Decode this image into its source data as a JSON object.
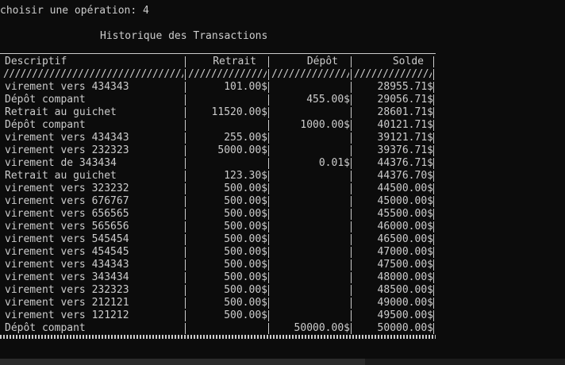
{
  "console": {
    "prompt": "choisir une opération: 4",
    "title": "Historique des Transactions"
  },
  "table": {
    "headers": {
      "description": "Descriptif",
      "retrait": "Retrait",
      "depot": "Dépôt",
      "solde": "Solde"
    },
    "rows": [
      {
        "description": "virement vers 434343",
        "retrait": "101.00$",
        "depot": "",
        "solde": "28955.71$"
      },
      {
        "description": "Dépôt compant",
        "retrait": "",
        "depot": "455.00$",
        "solde": "29056.71$"
      },
      {
        "description": "Retrait au guichet",
        "retrait": "11520.00$",
        "depot": "",
        "solde": "28601.71$"
      },
      {
        "description": "Dépôt compant",
        "retrait": "",
        "depot": "1000.00$",
        "solde": "40121.71$"
      },
      {
        "description": "virement vers 434343",
        "retrait": "255.00$",
        "depot": "",
        "solde": "39121.71$"
      },
      {
        "description": "virement vers 232323",
        "retrait": "5000.00$",
        "depot": "",
        "solde": "39376.71$"
      },
      {
        "description": "virement de 343434",
        "retrait": "",
        "depot": "0.01$",
        "solde": "44376.71$"
      },
      {
        "description": "Retrait au guichet",
        "retrait": "123.30$",
        "depot": "",
        "solde": "44376.70$"
      },
      {
        "description": "virement vers 323232",
        "retrait": "500.00$",
        "depot": "",
        "solde": "44500.00$"
      },
      {
        "description": "virement vers 676767",
        "retrait": "500.00$",
        "depot": "",
        "solde": "45000.00$"
      },
      {
        "description": "virement vers 656565",
        "retrait": "500.00$",
        "depot": "",
        "solde": "45500.00$"
      },
      {
        "description": "virement vers 565656",
        "retrait": "500.00$",
        "depot": "",
        "solde": "46000.00$"
      },
      {
        "description": "virement vers 545454",
        "retrait": "500.00$",
        "depot": "",
        "solde": "46500.00$"
      },
      {
        "description": "virement vers 454545",
        "retrait": "500.00$",
        "depot": "",
        "solde": "47000.00$"
      },
      {
        "description": "virement vers 434343",
        "retrait": "500.00$",
        "depot": "",
        "solde": "47500.00$"
      },
      {
        "description": "virement vers 343434",
        "retrait": "500.00$",
        "depot": "",
        "solde": "48000.00$"
      },
      {
        "description": "virement vers 232323",
        "retrait": "500.00$",
        "depot": "",
        "solde": "48500.00$"
      },
      {
        "description": "virement vers 212121",
        "retrait": "500.00$",
        "depot": "",
        "solde": "49000.00$"
      },
      {
        "description": "virement vers 121212",
        "retrait": "500.00$",
        "depot": "",
        "solde": "49500.00$"
      },
      {
        "description": "Dépôt compant",
        "retrait": "",
        "depot": "50000.00$",
        "solde": "50000.00$"
      }
    ]
  },
  "colors": {
    "background": "#0c0c0c",
    "text": "#cccccc"
  }
}
